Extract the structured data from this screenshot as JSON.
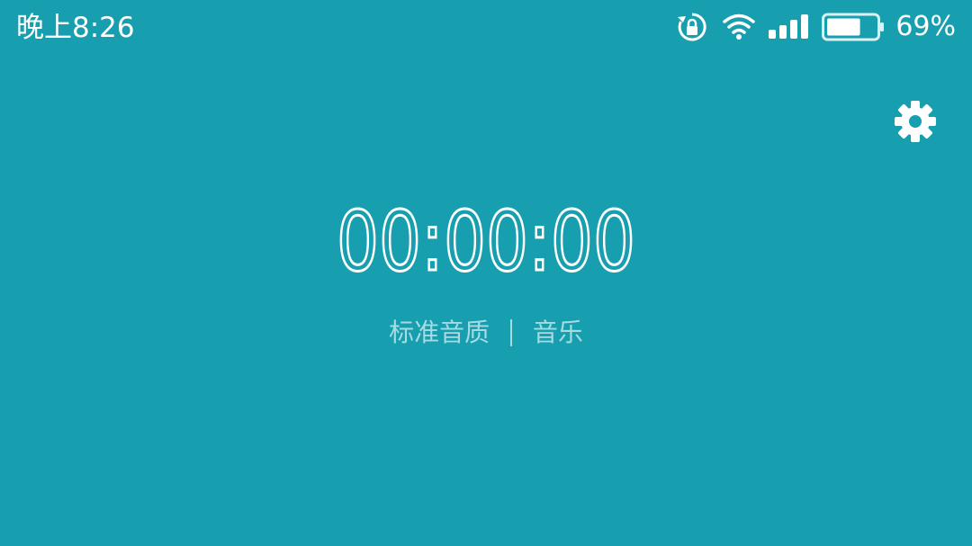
{
  "status_bar": {
    "time": "晚上8:26",
    "battery_percent_text": "69%",
    "battery_level": 0.69,
    "icons": [
      "rotate-lock-icon",
      "wifi-icon",
      "signal-icon",
      "battery-icon"
    ]
  },
  "settings": {
    "icon": "gear-icon"
  },
  "timer": {
    "display": "00:00:00"
  },
  "recording": {
    "quality": "标准音质",
    "mode": "音乐"
  },
  "colors": {
    "background": "#179faf",
    "foreground": "#ffffff",
    "muted_text": "#a6dbe2"
  }
}
